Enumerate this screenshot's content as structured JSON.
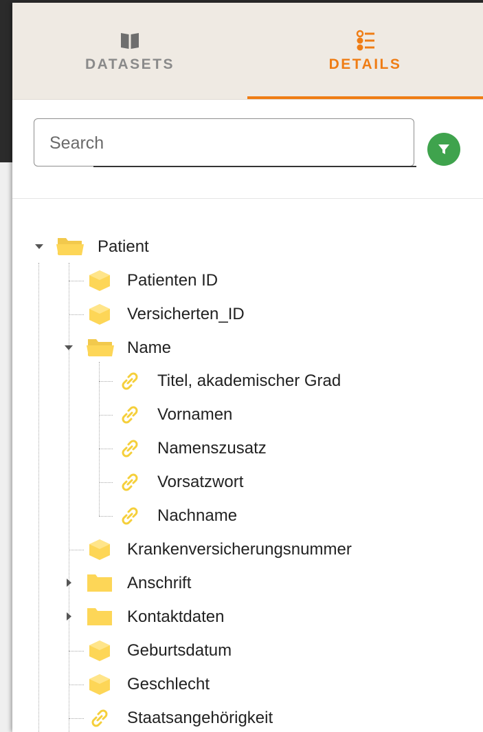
{
  "tabs": [
    {
      "label": "DATASETS",
      "icon": "book-icon",
      "active": false
    },
    {
      "label": "DETAILS",
      "icon": "list-icon",
      "active": true
    }
  ],
  "search": {
    "placeholder": "Search",
    "value": ""
  },
  "filter": {
    "icon": "filter-icon",
    "color": "#3fa34d"
  },
  "colors": {
    "accent": "#ef7d15",
    "folder": "#fdd657",
    "tab_bar": "#efeae3"
  },
  "tree": [
    {
      "label": "Patient",
      "type": "folder",
      "expanded": true,
      "children": [
        {
          "label": "Patienten ID",
          "type": "field"
        },
        {
          "label": "Versicherten_ID",
          "type": "field"
        },
        {
          "label": "Name",
          "type": "folder",
          "expanded": true,
          "children": [
            {
              "label": "Titel, akademischer Grad",
              "type": "link"
            },
            {
              "label": "Vornamen",
              "type": "link"
            },
            {
              "label": "Namenszusatz",
              "type": "link"
            },
            {
              "label": "Vorsatzwort",
              "type": "link"
            },
            {
              "label": "Nachname",
              "type": "link"
            }
          ]
        },
        {
          "label": "Krankenversicherungsnummer",
          "type": "field"
        },
        {
          "label": "Anschrift",
          "type": "folder",
          "expanded": false
        },
        {
          "label": "Kontaktdaten",
          "type": "folder",
          "expanded": false
        },
        {
          "label": "Geburtsdatum",
          "type": "field"
        },
        {
          "label": "Geschlecht",
          "type": "field"
        },
        {
          "label": "Staatsangehörigkeit",
          "type": "link"
        }
      ]
    }
  ]
}
